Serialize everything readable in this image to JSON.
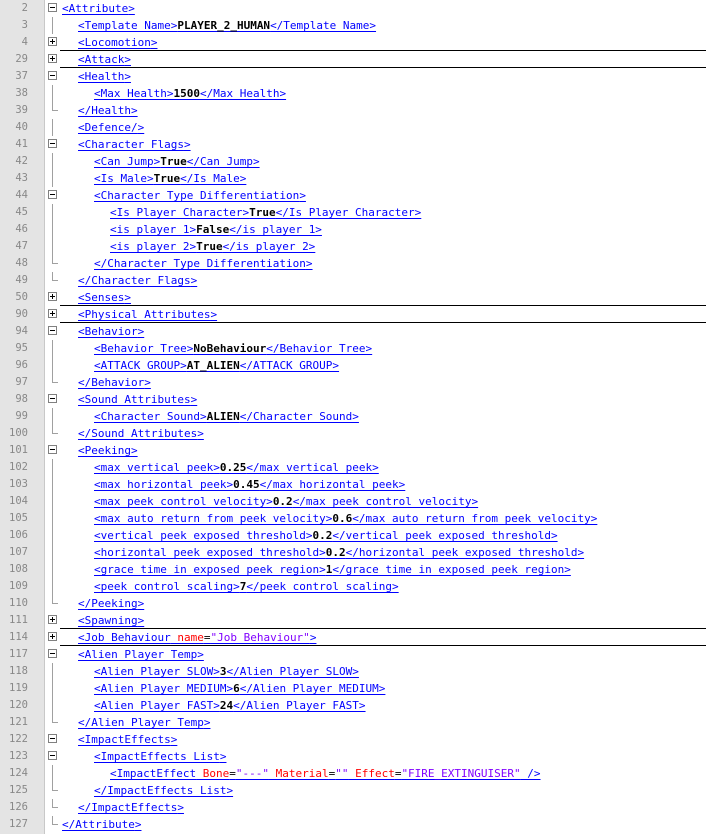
{
  "lines": [
    {
      "n": "2",
      "fold": "minus",
      "indent": 0,
      "tag": "Attribute"
    },
    {
      "n": "3",
      "fold": "",
      "indent": 1,
      "open": "Template_Name",
      "val": "PLAYER_2_HUMAN",
      "close": "Template_Name"
    },
    {
      "n": "4",
      "fold": "plus",
      "indent": 1,
      "tag": "Locomotion",
      "sep": true
    },
    {
      "n": "29",
      "fold": "plus",
      "indent": 1,
      "tag": "Attack",
      "sep": true
    },
    {
      "n": "37",
      "fold": "minus",
      "indent": 1,
      "tag": "Health"
    },
    {
      "n": "38",
      "fold": "",
      "indent": 2,
      "open": "Max_Health",
      "val": "1500",
      "close": "Max_Health"
    },
    {
      "n": "39",
      "fold": "end",
      "indent": 1,
      "tag": "/Health"
    },
    {
      "n": "40",
      "fold": "",
      "indent": 1,
      "tag": "Defence/"
    },
    {
      "n": "41",
      "fold": "minus",
      "indent": 1,
      "tag": "Character_Flags"
    },
    {
      "n": "42",
      "fold": "",
      "indent": 2,
      "open": "Can_Jump",
      "val": "True",
      "close": "Can_Jump"
    },
    {
      "n": "43",
      "fold": "",
      "indent": 2,
      "open": "Is_Male",
      "val": "True",
      "close": "Is_Male"
    },
    {
      "n": "44",
      "fold": "minus",
      "indent": 2,
      "tag": "Character_Type_Differentiation"
    },
    {
      "n": "45",
      "fold": "",
      "indent": 3,
      "open": "Is_Player_Character",
      "val": "True",
      "close": "Is_Player_Character"
    },
    {
      "n": "46",
      "fold": "",
      "indent": 3,
      "open": "is_player_1",
      "val": "False",
      "close": "is_player_1"
    },
    {
      "n": "47",
      "fold": "",
      "indent": 3,
      "open": "is_player_2",
      "val": "True",
      "close": "is_player_2"
    },
    {
      "n": "48",
      "fold": "end",
      "indent": 2,
      "tag": "/Character_Type_Differentiation"
    },
    {
      "n": "49",
      "fold": "end",
      "indent": 1,
      "tag": "/Character_Flags"
    },
    {
      "n": "50",
      "fold": "plus",
      "indent": 1,
      "tag": "Senses",
      "sep": true
    },
    {
      "n": "90",
      "fold": "plus",
      "indent": 1,
      "tag": "Physical_Attributes",
      "sep": true
    },
    {
      "n": "94",
      "fold": "minus",
      "indent": 1,
      "tag": "Behavior"
    },
    {
      "n": "95",
      "fold": "",
      "indent": 2,
      "open": "Behavior_Tree",
      "val": "NoBehaviour",
      "close": "Behavior_Tree"
    },
    {
      "n": "96",
      "fold": "",
      "indent": 2,
      "open": "ATTACK_GROUP",
      "val": "AT_ALIEN",
      "close": "ATTACK_GROUP"
    },
    {
      "n": "97",
      "fold": "end",
      "indent": 1,
      "tag": "/Behavior"
    },
    {
      "n": "98",
      "fold": "minus",
      "indent": 1,
      "tag": "Sound_Attributes"
    },
    {
      "n": "99",
      "fold": "",
      "indent": 2,
      "open": "Character_Sound",
      "val": "ALIEN",
      "close": "Character_Sound"
    },
    {
      "n": "100",
      "fold": "end",
      "indent": 1,
      "tag": "/Sound_Attributes"
    },
    {
      "n": "101",
      "fold": "minus",
      "indent": 1,
      "tag": "Peeking"
    },
    {
      "n": "102",
      "fold": "",
      "indent": 2,
      "open": "max_vertical_peek",
      "val": "0.25",
      "close": "max_vertical_peek"
    },
    {
      "n": "103",
      "fold": "",
      "indent": 2,
      "open": "max_horizontal_peek",
      "val": "0.45",
      "close": "max_horizontal_peek"
    },
    {
      "n": "104",
      "fold": "",
      "indent": 2,
      "open": "max_peek_control_velocity",
      "val": "0.2",
      "close": "max_peek_control_velocity"
    },
    {
      "n": "105",
      "fold": "",
      "indent": 2,
      "open": "max_auto_return_from_peek_velocity",
      "val": "0.6",
      "close": "max_auto_return_from_peek_velocity"
    },
    {
      "n": "106",
      "fold": "",
      "indent": 2,
      "open": "vertical_peek_exposed_threshold",
      "val": "0.2",
      "close": "vertical_peek_exposed_threshold"
    },
    {
      "n": "107",
      "fold": "",
      "indent": 2,
      "open": "horizontal_peek_exposed_threshold",
      "val": "0.2",
      "close": "horizontal_peek_exposed_threshold"
    },
    {
      "n": "108",
      "fold": "",
      "indent": 2,
      "open": "grace_time_in_exposed_peek_region",
      "val": "1",
      "close": "grace_time_in_exposed_peek_region"
    },
    {
      "n": "109",
      "fold": "",
      "indent": 2,
      "open": "peek_control_scaling",
      "val": "7",
      "close": "peek_control_scaling"
    },
    {
      "n": "110",
      "fold": "end",
      "indent": 1,
      "tag": "/Peeking"
    },
    {
      "n": "111",
      "fold": "plus",
      "indent": 1,
      "tag": "Spawning",
      "sep": true
    },
    {
      "n": "114",
      "fold": "plus",
      "indent": 1,
      "tag": "Job_Behaviour",
      "attrs": [
        {
          "name": "name",
          "value": "Job Behaviour"
        }
      ],
      "sep": true
    },
    {
      "n": "117",
      "fold": "minus",
      "indent": 1,
      "tag": "Alien_Player_Temp"
    },
    {
      "n": "118",
      "fold": "",
      "indent": 2,
      "open": "Alien_Player_SLOW",
      "val": "3",
      "close": "Alien_Player_SLOW"
    },
    {
      "n": "119",
      "fold": "",
      "indent": 2,
      "open": "Alien_Player_MEDIUM",
      "val": "6",
      "close": "Alien_Player_MEDIUM"
    },
    {
      "n": "120",
      "fold": "",
      "indent": 2,
      "open": "Alien_Player_FAST",
      "val": "24",
      "close": "Alien_Player_FAST"
    },
    {
      "n": "121",
      "fold": "end",
      "indent": 1,
      "tag": "/Alien_Player_Temp"
    },
    {
      "n": "122",
      "fold": "minus",
      "indent": 1,
      "tag": "ImpactEffects"
    },
    {
      "n": "123",
      "fold": "minus",
      "indent": 2,
      "tag": "ImpactEffects_List"
    },
    {
      "n": "124",
      "fold": "",
      "indent": 3,
      "tag": "ImpactEffect",
      "attrs": [
        {
          "name": "Bone",
          "value": "---"
        },
        {
          "name": "Material",
          "value": ""
        },
        {
          "name": "Effect",
          "value": "FIRE_EXTINGUISER"
        }
      ],
      "selfclose": true
    },
    {
      "n": "125",
      "fold": "end",
      "indent": 2,
      "tag": "/ImpactEffects_List"
    },
    {
      "n": "126",
      "fold": "end",
      "indent": 1,
      "tag": "/ImpactEffects"
    },
    {
      "n": "127",
      "fold": "end",
      "indent": 0,
      "tag": "/Attribute"
    }
  ]
}
